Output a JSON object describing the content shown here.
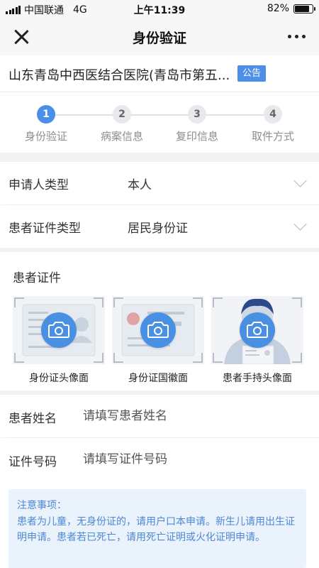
{
  "status_bar": {
    "carrier": "中国联通",
    "network": "4G",
    "time": "上午11:39",
    "battery_text": "82%",
    "battery_level": 0.82
  },
  "nav": {
    "title": "身份验证"
  },
  "hospital": {
    "name": "山东青岛中西医结合医院(青岛市第五...",
    "notice_label": "公告"
  },
  "steps": [
    {
      "number": "1",
      "label": "身份验证",
      "active": true
    },
    {
      "number": "2",
      "label": "病案信息",
      "active": false
    },
    {
      "number": "3",
      "label": "复印信息",
      "active": false
    },
    {
      "number": "4",
      "label": "取件方式",
      "active": false
    }
  ],
  "form": {
    "applicant_type": {
      "label": "申请人类型",
      "value": "本人"
    },
    "id_type": {
      "label": "患者证件类型",
      "value": "居民身份证"
    }
  },
  "upload": {
    "title": "患者证件",
    "cards": [
      {
        "label": "身份证头像面",
        "icon": "camera-icon"
      },
      {
        "label": "身份证国徽面",
        "icon": "camera-icon"
      },
      {
        "label": "患者手持头像面",
        "icon": "camera-icon"
      }
    ]
  },
  "patient_name": {
    "label": "患者姓名",
    "placeholder": "请填写患者姓名"
  },
  "id_number": {
    "label": "证件号码",
    "placeholder": "请填写证件号码"
  },
  "notes": {
    "title": "注意事项：",
    "text": "患者为儿童，无身份证的，请用户口本申请。新生儿请用出生证明申请。患者若已死亡，请用死亡证明或火化证明申请。"
  },
  "colors": {
    "accent": "#4a90e2",
    "notice_text": "#4d87d6",
    "notice_bg": "#eaf3fc"
  }
}
